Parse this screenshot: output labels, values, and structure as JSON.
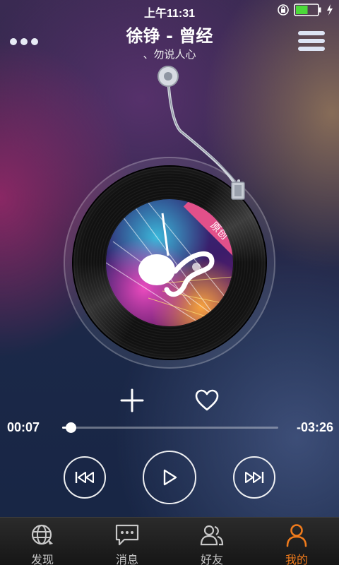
{
  "status_bar": {
    "time": "上午11:31",
    "battery_level": 0.55
  },
  "header": {
    "song_title": "徐铮 - 曾经",
    "artist_line": "、勿说人心"
  },
  "album": {
    "badge_text": "原创"
  },
  "playback": {
    "elapsed": "00:07",
    "remaining": "-03:26",
    "progress": 0.04
  },
  "tabs": [
    {
      "label": "发现",
      "icon": "globe-icon",
      "active": false
    },
    {
      "label": "消息",
      "icon": "chat-icon",
      "active": false
    },
    {
      "label": "好友",
      "icon": "friends-icon",
      "active": false
    },
    {
      "label": "我的",
      "icon": "person-icon",
      "active": true
    }
  ],
  "colors": {
    "accent": "#f07b1c",
    "badge": "#e2508a"
  }
}
